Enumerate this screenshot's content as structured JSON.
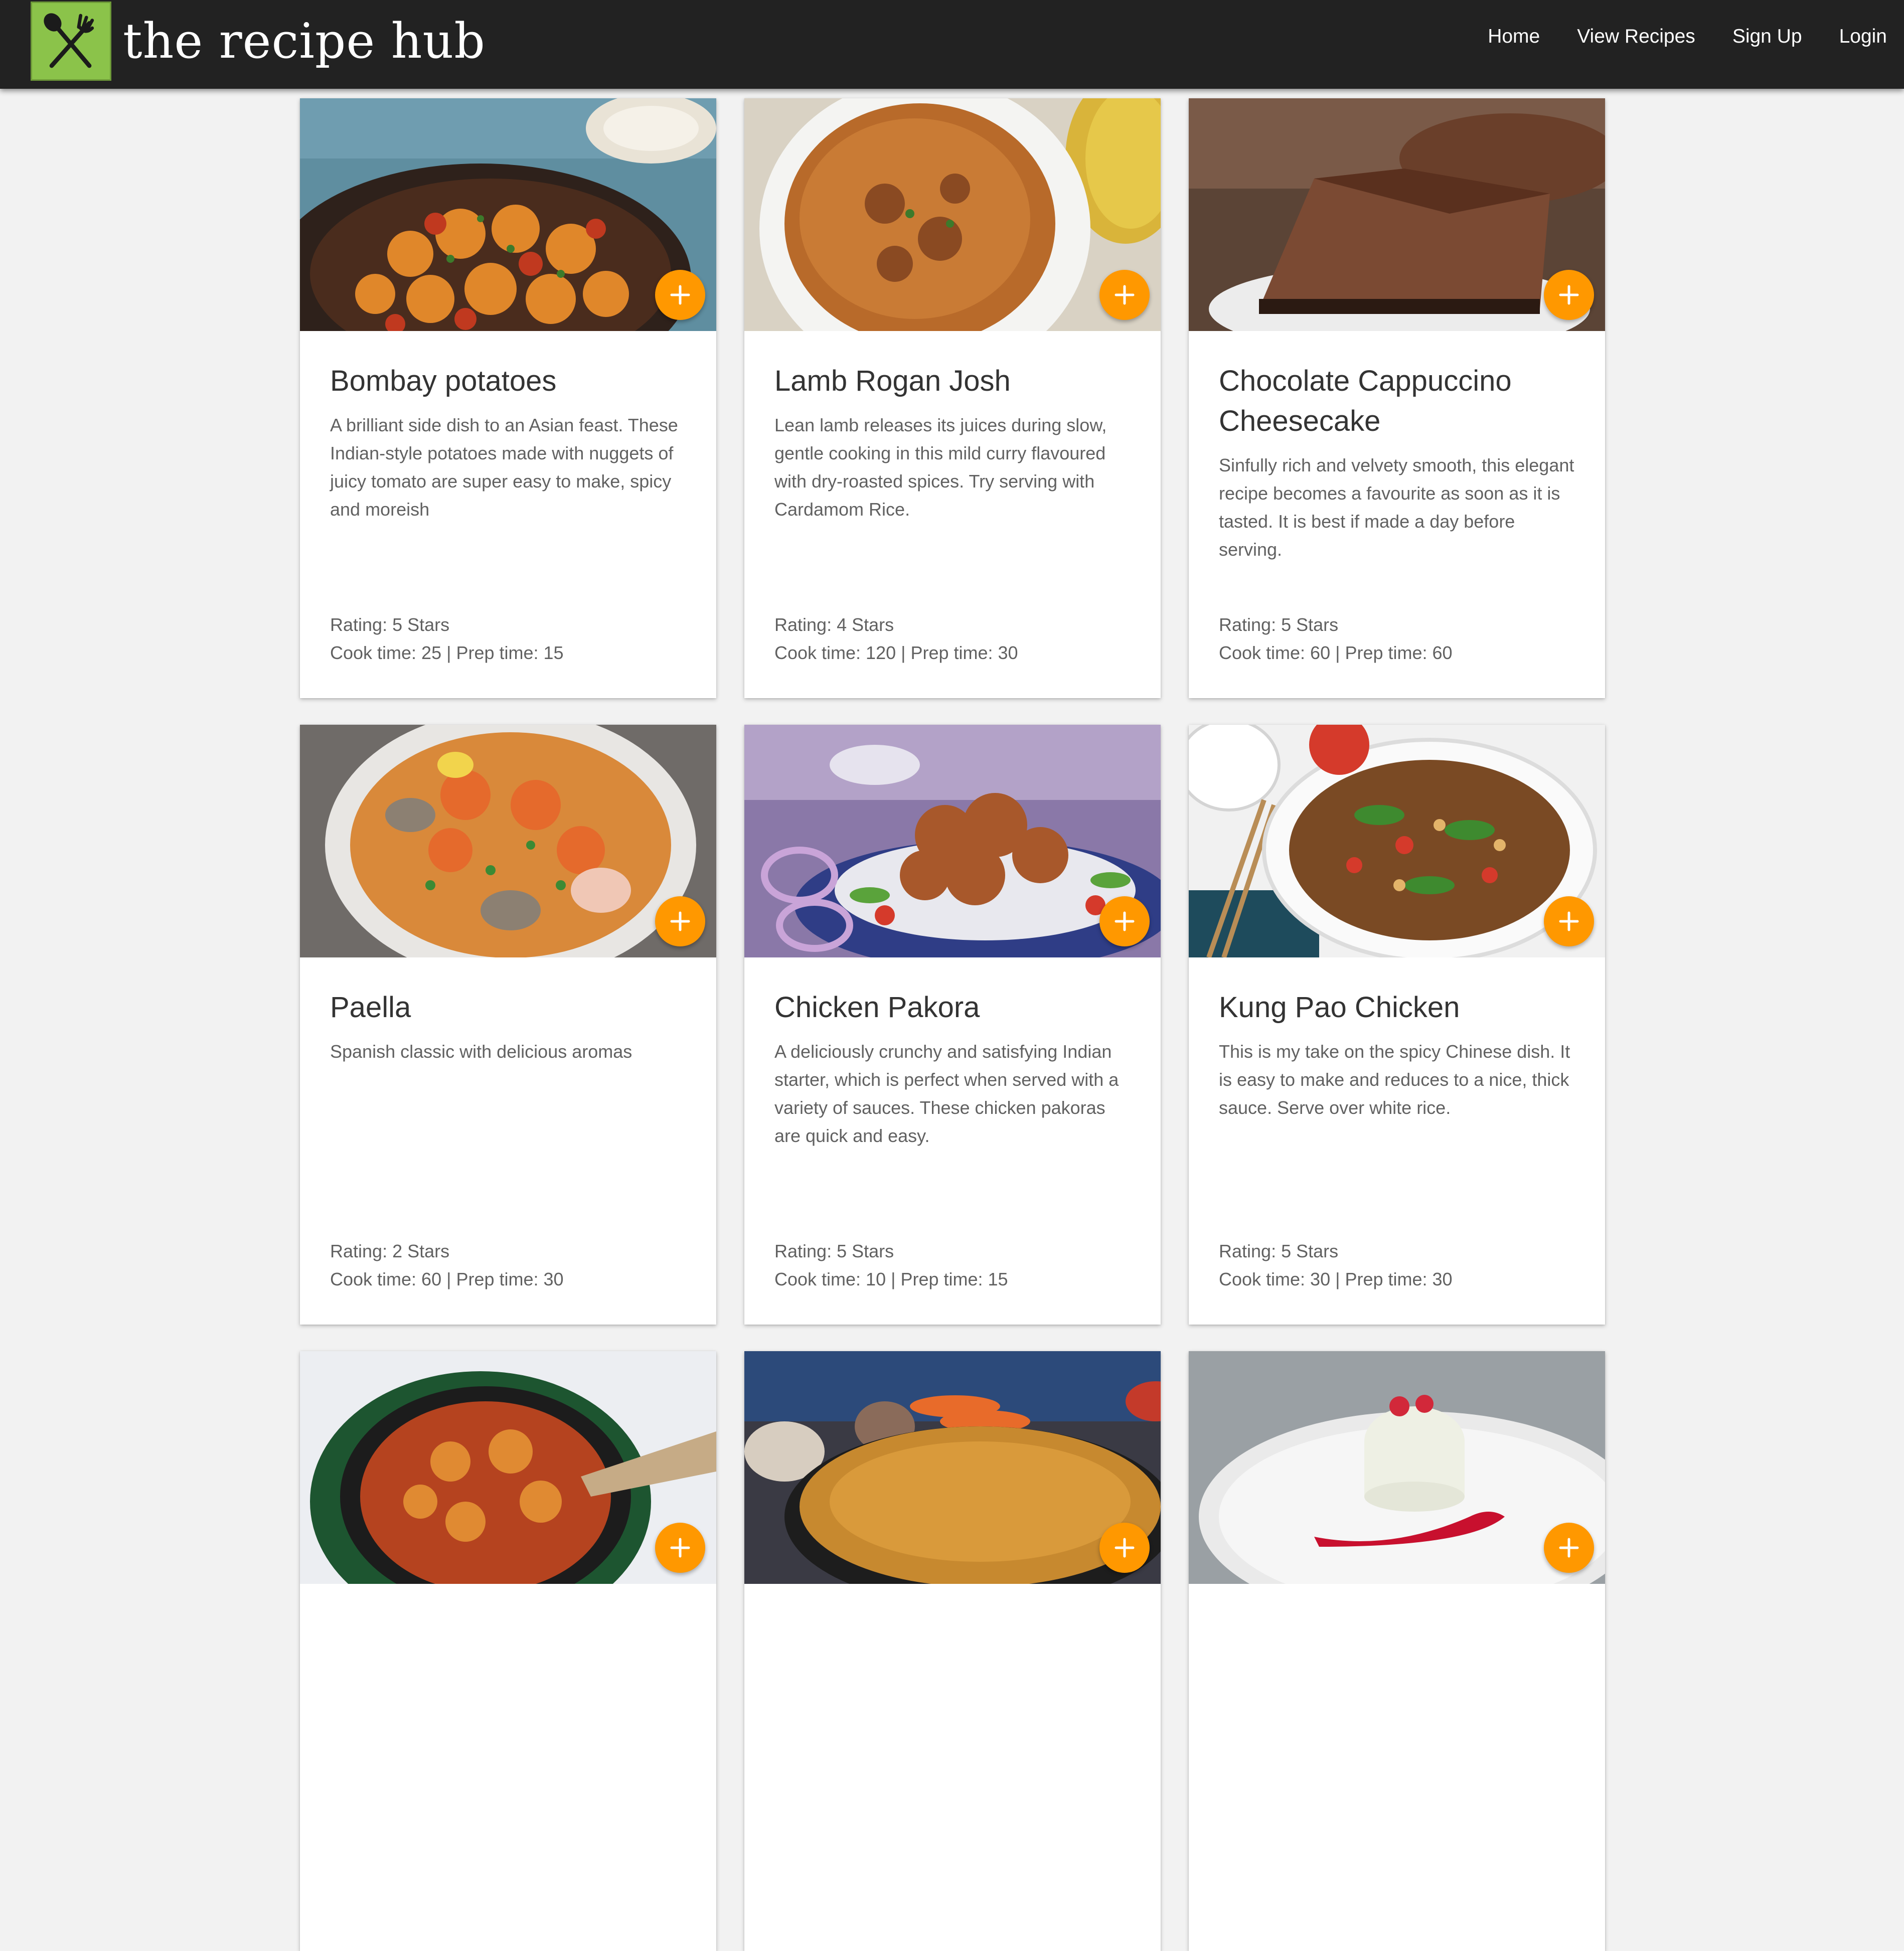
{
  "header": {
    "brand": "the recipe hub",
    "logo_icon": "spoon-and-fork-icon",
    "nav": [
      {
        "label": "Home"
      },
      {
        "label": "View Recipes"
      },
      {
        "label": "Sign Up"
      },
      {
        "label": "Login"
      }
    ]
  },
  "colors": {
    "navbar_bg": "#222222",
    "logo_bg": "#8bc34a",
    "add_button": "#ff9800",
    "page_bg": "#f2f2f2"
  },
  "recipes": [
    {
      "title": "Bombay potatoes",
      "description": "A brilliant side dish to an Asian feast. These Indian-style potatoes made with nuggets of juicy tomato are super easy to make, spicy and moreish",
      "rating": "Rating: 5 Stars",
      "times": "Cook time: 25 | Prep time: 15",
      "image_icon": "bombay-potatoes-photo"
    },
    {
      "title": "Lamb Rogan Josh",
      "description": "Lean lamb releases its juices during slow, gentle cooking in this mild curry flavoured with dry-roasted spices. Try serving with Cardamom Rice.",
      "rating": "Rating: 4 Stars",
      "times": "Cook time: 120 | Prep time: 30",
      "image_icon": "lamb-rogan-josh-photo"
    },
    {
      "title": "Chocolate Cappuccino Cheesecake",
      "description": "Sinfully rich and velvety smooth, this elegant recipe becomes a favourite as soon as it is tasted. It is best if made a day before serving.",
      "rating": "Rating: 5 Stars",
      "times": "Cook time: 60 | Prep time: 60",
      "image_icon": "chocolate-cheesecake-photo"
    },
    {
      "title": "Paella",
      "description": "Spanish classic with delicious aromas",
      "rating": "Rating: 2 Stars",
      "times": "Cook time: 60 | Prep time: 30",
      "image_icon": "paella-photo"
    },
    {
      "title": "Chicken Pakora",
      "description": "A deliciously crunchy and satisfying Indian starter, which is perfect when served with a variety of sauces. These chicken pakoras are quick and easy.",
      "rating": "Rating: 5 Stars",
      "times": "Cook time: 10 | Prep time: 15",
      "image_icon": "chicken-pakora-photo"
    },
    {
      "title": "Kung Pao Chicken",
      "description": "This is my take on the spicy Chinese dish. It is easy to make and reduces to a nice, thick sauce. Serve over white rice.",
      "rating": "Rating: 5 Stars",
      "times": "Cook time: 30 | Prep time: 30",
      "image_icon": "kung-pao-chicken-photo"
    },
    {
      "title": "",
      "description": "",
      "rating": "",
      "times": "",
      "image_icon": "stew-pot-photo"
    },
    {
      "title": "",
      "description": "",
      "rating": "",
      "times": "",
      "image_icon": "pie-photo"
    },
    {
      "title": "",
      "description": "",
      "rating": "",
      "times": "",
      "image_icon": "panna-cotta-photo"
    }
  ]
}
